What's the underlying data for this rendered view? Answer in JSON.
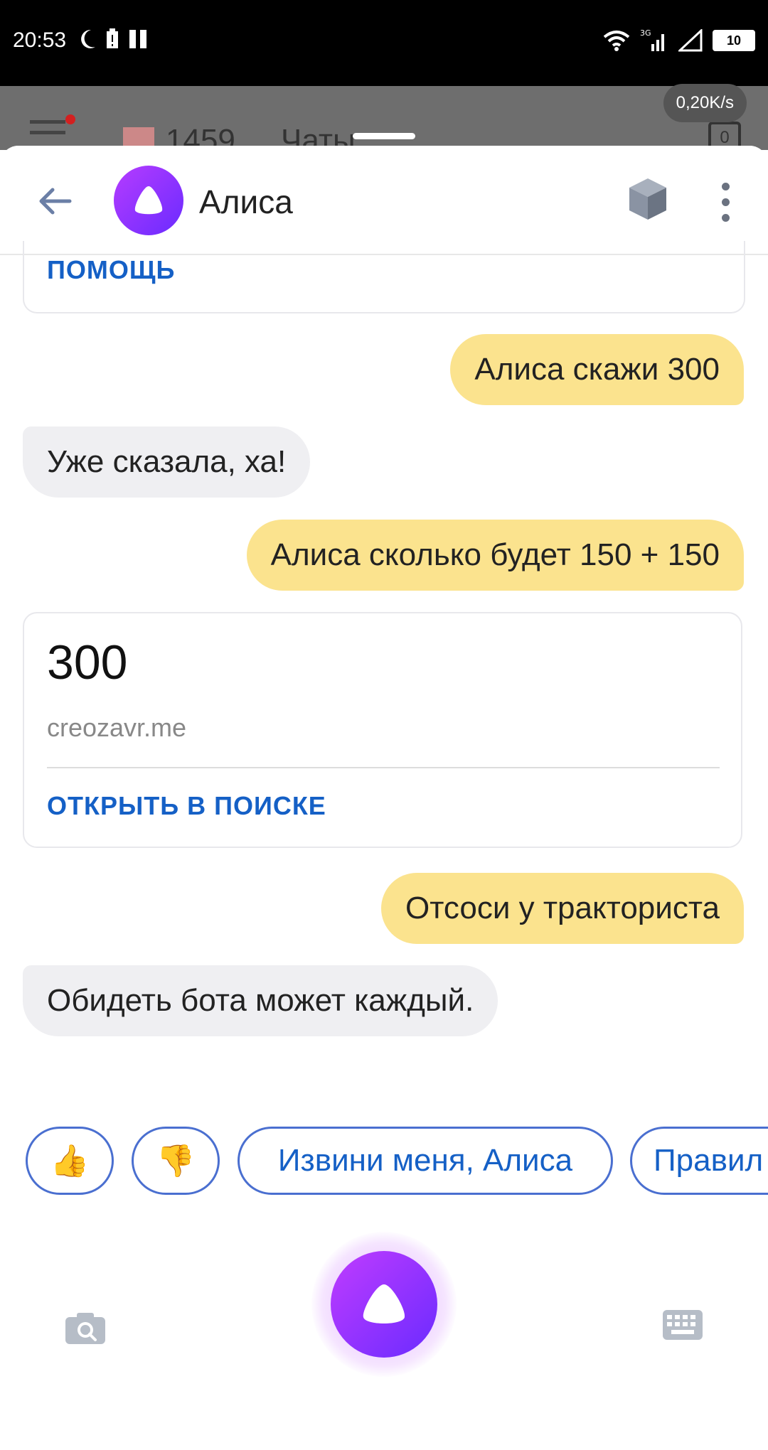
{
  "status_bar": {
    "time": "20:53",
    "network_type": "3G",
    "battery": "10",
    "speed": "0,20K/s"
  },
  "background_app": {
    "mail_count": "1459",
    "chats_label": "Чаты",
    "tabs_count": "0"
  },
  "header": {
    "title": "Алиса",
    "icons": [
      "back-arrow-icon",
      "alice-avatar-icon",
      "cube-icon",
      "more-vert-icon"
    ]
  },
  "chat": {
    "help_link": "ПОМОЩЬ",
    "messages": [
      {
        "from": "user",
        "text": "Алиса скажи 300"
      },
      {
        "from": "bot",
        "text": "Уже сказала, ха!"
      },
      {
        "from": "user",
        "text": "Алиса сколько будет 150 + 150"
      },
      {
        "from": "user",
        "text": "Отсоси у тракториста"
      },
      {
        "from": "bot",
        "text": "Обидеть бота может каждый."
      }
    ],
    "answer_card": {
      "value": "300",
      "source": "creozavr.me",
      "link": "ОТКРЫТЬ В ПОИСКЕ"
    }
  },
  "suggestions": {
    "like": "👍",
    "dislike": "👎",
    "apologize": "Извини меня, Алиса",
    "rules": "Правил"
  },
  "bottom_bar": {
    "icons": [
      "camera-search-icon",
      "alice-mic-icon",
      "keyboard-icon"
    ]
  },
  "colors": {
    "user_bubble": "#fbe38e",
    "bot_bubble": "#efeff2",
    "link": "#1560c6",
    "accent_purple": "#8a33ff"
  }
}
